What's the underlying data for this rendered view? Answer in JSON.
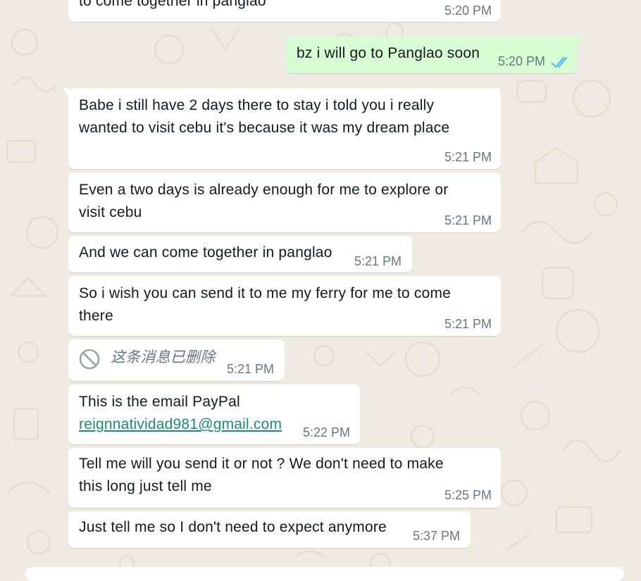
{
  "chat": {
    "messages": [
      {
        "id": "m0",
        "text": "to come together in panglao",
        "time": "5:20 PM"
      },
      {
        "id": "m1",
        "text": "bz i will go to Panglao soon",
        "time": "5:20 PM",
        "status_icon": "double-check-icon",
        "status_color": "#53bdeb"
      },
      {
        "id": "m2",
        "lines": [
          "Babe i still have 2 days there to stay i told you i really",
          "wanted to visit cebu it's because it was my dream place"
        ],
        "time": "5:21 PM"
      },
      {
        "id": "m3",
        "lines": [
          "Even a two days is already enough for me to explore or",
          "visit cebu"
        ],
        "time": "5:21 PM"
      },
      {
        "id": "m4",
        "text": "And we can come together in panglao",
        "time": "5:21 PM"
      },
      {
        "id": "m5",
        "lines": [
          "So i wish you can send it to me my ferry for me to come",
          "there"
        ],
        "time": "5:21 PM"
      },
      {
        "id": "m6",
        "text": "这条消息已删除",
        "time": "5:21 PM",
        "icon": "blocked-icon"
      },
      {
        "id": "m7",
        "lines": [
          "This is the email PayPal",
          "reignnatividad981@gmail.com"
        ],
        "time": "5:22 PM"
      },
      {
        "id": "m8",
        "lines": [
          "Tell me will you send it or not ? We don't need to make",
          "this long just tell me"
        ],
        "time": "5:25 PM"
      },
      {
        "id": "m9",
        "text": "Just tell me so I don't need to expect anymore",
        "time": "5:37 PM"
      }
    ]
  },
  "colors": {
    "background": "#efeae2",
    "incoming": "#ffffff",
    "outgoing": "#d9fdd3",
    "timestamp": "#667781",
    "link": "#1f8a6f",
    "read_tick": "#53bdeb"
  }
}
